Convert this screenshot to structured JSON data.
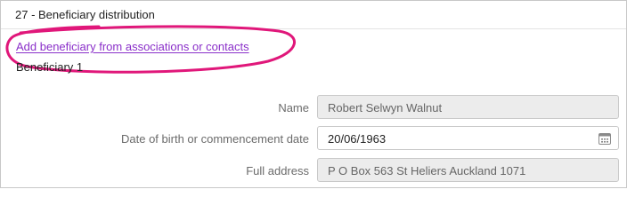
{
  "section": {
    "title": "27 - Beneficiary distribution",
    "add_link": "Add beneficiary from associations or contacts",
    "beneficiary_label": "Beneficiary 1"
  },
  "fields": {
    "name": {
      "label": "Name",
      "value": "Robert Selwyn Walnut"
    },
    "dob": {
      "label": "Date of birth or commencement date",
      "value": "20/06/1963",
      "icon": "calendar-icon"
    },
    "address": {
      "label": "Full address",
      "value": "P O Box 563 St Heliers Auckland 1071"
    }
  },
  "colors": {
    "link": "#8a2fc9",
    "highlight": "#e0177a",
    "readonly_bg": "#ececec"
  }
}
